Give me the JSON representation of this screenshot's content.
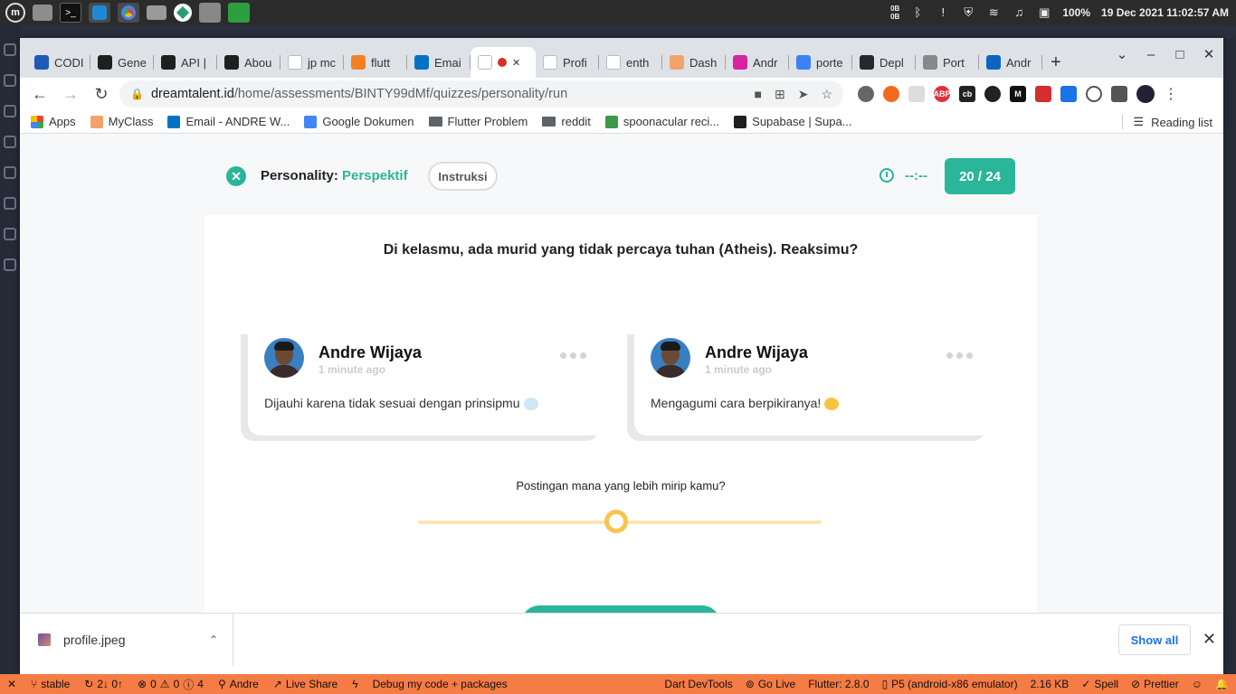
{
  "os": {
    "battery": "100%",
    "datetime": "19 Dec 2021 11:02:57 AM",
    "net_up": "0B",
    "net_down": "0B"
  },
  "browser": {
    "tabs": [
      {
        "label": "CODI",
        "icon": "codepen-icon",
        "color": "#1e5bb8"
      },
      {
        "label": "Gene",
        "icon": "supabase-icon",
        "color": "#1f1f1f"
      },
      {
        "label": "API |",
        "icon": "supabase-icon",
        "color": "#1f1f1f"
      },
      {
        "label": "Abou",
        "icon": "supabase-icon",
        "color": "#1f1f1f"
      },
      {
        "label": "jp mc",
        "icon": "google-icon",
        "color": "#ffffff"
      },
      {
        "label": "flutt",
        "icon": "stackoverflow-icon",
        "color": "#f48024"
      },
      {
        "label": "Emai",
        "icon": "outlook-icon",
        "color": "#0072c6"
      },
      {
        "label": "",
        "icon": "dreamtalent-icon",
        "color": "#ffffff",
        "active": true
      },
      {
        "label": "Profi",
        "icon": "dreamtalent-icon",
        "color": "#ffffff"
      },
      {
        "label": "enth",
        "icon": "google-icon",
        "color": "#ffffff"
      },
      {
        "label": "Dash",
        "icon": "dash-icon",
        "color": "#f2a36b"
      },
      {
        "label": "Andr",
        "icon": "instagram-icon",
        "color": "#d6249f"
      },
      {
        "label": "porte",
        "icon": "portainer-icon",
        "color": "#3b82f6"
      },
      {
        "label": "Depl",
        "icon": "github-icon",
        "color": "#24292e"
      },
      {
        "label": "Port",
        "icon": "page-icon",
        "color": "#888888"
      },
      {
        "label": "Andr",
        "icon": "linkedin-icon",
        "color": "#0a66c2"
      }
    ],
    "url_host": "dreamtalent.id",
    "url_path": "/home/assessments/BINTY99dMf/quizzes/personality/run",
    "bookmarks": [
      {
        "label": "Apps",
        "icon": "apps-icon"
      },
      {
        "label": "MyClass",
        "icon": "myclass-icon"
      },
      {
        "label": "Email - ANDRE W...",
        "icon": "outlook-icon"
      },
      {
        "label": "Google Dokumen",
        "icon": "docs-icon"
      },
      {
        "label": "Flutter Problem",
        "icon": "folder-icon"
      },
      {
        "label": "reddit",
        "icon": "folder-icon"
      },
      {
        "label": "spoonacular reci...",
        "icon": "spoonacular-icon"
      },
      {
        "label": "Supabase | Supa...",
        "icon": "supabase-icon"
      }
    ],
    "reading_list": "Reading list"
  },
  "quiz": {
    "title_prefix": "Personality:",
    "title_category": "Perspektif",
    "instructions_button": "Instruksi",
    "timer": "--:--",
    "progress": "20 / 24",
    "question": "Di kelasmu, ada murid yang tidak percaya tuhan (Atheis). Reaksimu?",
    "posts": [
      {
        "name": "Andre Wijaya",
        "time": "1 minute ago",
        "text": "Dijauhi karena tidak sesuai dengan prinsipmu",
        "emoji": "dash-emoji"
      },
      {
        "name": "Andre Wijaya",
        "time": "1 minute ago",
        "text": "Mengagumi cara berpikiranya!",
        "emoji": "thinking-emoji"
      }
    ],
    "slider_prompt": "Postingan mana yang lebih mirip kamu?",
    "slider_value": 0.49,
    "accent_color": "#2bb59a",
    "slider_color": "#f7c450"
  },
  "downloads": {
    "file": "profile.jpeg",
    "show_all": "Show all"
  },
  "statusbar": {
    "branch": "stable",
    "sync": "2↓ 0↑",
    "errors": "0",
    "warnings": "0",
    "infos": "4",
    "user": "Andre",
    "live_share": "Live Share",
    "debug": "Debug my code + packages",
    "devtools": "Dart DevTools",
    "golive": "Go Live",
    "flutter": "Flutter: 2.8.0",
    "device": "P5 (android-x86 emulator)",
    "size": "2.16 KB",
    "spell": "Spell",
    "prettier": "Prettier"
  }
}
